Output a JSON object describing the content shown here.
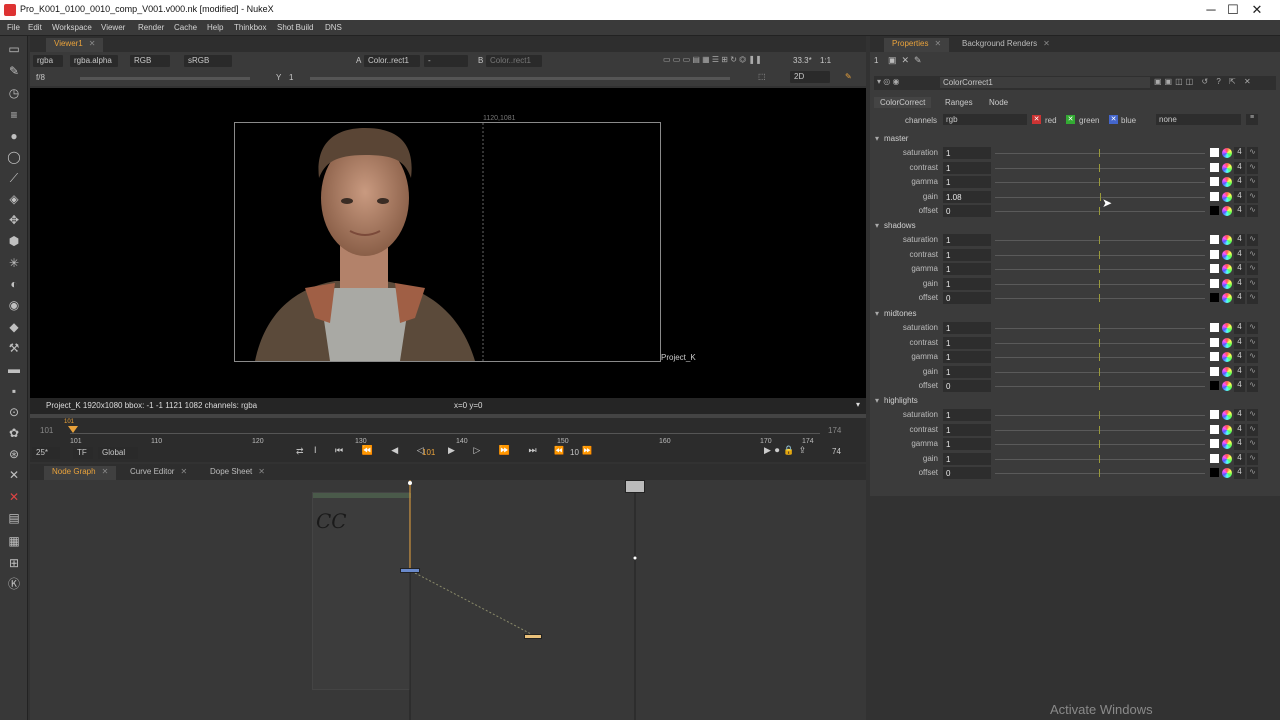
{
  "window": {
    "title": "Pro_K001_0100_0010_comp_V001.v000.nk [modified] - NukeX",
    "min": "─",
    "max": "☐",
    "close": "✕"
  },
  "menu": [
    "File",
    "Edit",
    "Workspace",
    "Viewer",
    "Render",
    "Cache",
    "Help",
    "Thinkbox",
    "Shot Build",
    "DNS"
  ],
  "viewer": {
    "tab": "Viewer1",
    "channels": "rgba",
    "alpha": "rgba.alpha",
    "rgb": "RGB",
    "lut": "sRGB",
    "inputA_label": "A",
    "inputA": "Color..rect1",
    "inputA_op": "-",
    "inputB_label": "B",
    "inputB": "Color..rect1",
    "zoom": "33.3*",
    "ratio": "1:1",
    "mode": "2D",
    "fstop": "f/8",
    "y_label": "Y",
    "y_val": "1",
    "format_label": "1120,1081",
    "node_label": "Project_K",
    "info": "Project_K 1920x1080  bbox: -1 -1 1121 1082 channels: rgba",
    "coords": "x=0 y=0"
  },
  "timeline": {
    "start": "101",
    "end": "174",
    "ticks": [
      "101",
      "110",
      "120",
      "130",
      "140",
      "150",
      "160",
      "170",
      "174"
    ],
    "current": "101",
    "fps": "25*",
    "tf": "TF",
    "global": "Global",
    "current_frame": "101",
    "step": "10",
    "end_frame": "74",
    "playhead": "101"
  },
  "graph": {
    "tabs": [
      "Node Graph",
      "Curve Editor",
      "Dope Sheet"
    ],
    "backdrop_text": "CC"
  },
  "props": {
    "tabs": [
      "Properties",
      "Background Renders"
    ],
    "node": "ColorCorrect1",
    "node_tabs": [
      "ColorCorrect",
      "Ranges",
      "Node"
    ],
    "count": "1",
    "channels_label": "channels",
    "channels_val": "rgb",
    "red": "red",
    "green": "green",
    "blue": "blue",
    "none": "none",
    "sections": [
      {
        "name": "master",
        "rows": [
          {
            "l": "saturation",
            "v": "1"
          },
          {
            "l": "contrast",
            "v": "1"
          },
          {
            "l": "gamma",
            "v": "1"
          },
          {
            "l": "gain",
            "v": "1.08"
          },
          {
            "l": "offset",
            "v": "0"
          }
        ]
      },
      {
        "name": "shadows",
        "rows": [
          {
            "l": "saturation",
            "v": "1"
          },
          {
            "l": "contrast",
            "v": "1"
          },
          {
            "l": "gamma",
            "v": "1"
          },
          {
            "l": "gain",
            "v": "1"
          },
          {
            "l": "offset",
            "v": "0"
          }
        ]
      },
      {
        "name": "midtones",
        "rows": [
          {
            "l": "saturation",
            "v": "1"
          },
          {
            "l": "contrast",
            "v": "1"
          },
          {
            "l": "gamma",
            "v": "1"
          },
          {
            "l": "gain",
            "v": "1"
          },
          {
            "l": "offset",
            "v": "0"
          }
        ]
      },
      {
        "name": "highlights",
        "rows": [
          {
            "l": "saturation",
            "v": "1"
          },
          {
            "l": "contrast",
            "v": "1"
          },
          {
            "l": "gamma",
            "v": "1"
          },
          {
            "l": "gain",
            "v": "1"
          },
          {
            "l": "offset",
            "v": "0"
          }
        ]
      }
    ]
  },
  "watermark": "Activate Windows"
}
